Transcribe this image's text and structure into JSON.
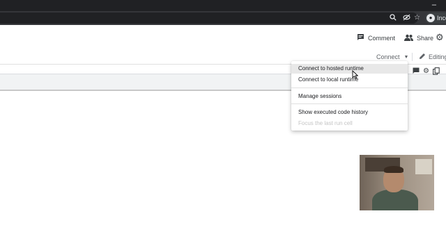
{
  "browser": {
    "incognito_label": "Inco",
    "icons": [
      "zoom-icon",
      "eye-off-icon",
      "star-icon",
      "incognito-icon"
    ],
    "minimize_glyph": "–"
  },
  "header": {
    "comment_label": "Comment",
    "share_label": "Share",
    "icons": [
      "comment-icon",
      "share-people-icon",
      "settings-gear-icon"
    ]
  },
  "toolbar": {
    "connect_label": "Connect",
    "editing_label": "Editing"
  },
  "cell_toolbar": {
    "icons": [
      "comment-icon",
      "gear-icon",
      "copy-icon"
    ]
  },
  "runtime_menu": {
    "items": [
      {
        "label": "Connect to hosted runtime",
        "enabled": true,
        "highlighted": true
      },
      {
        "label": "Connect to local runtime",
        "enabled": true
      },
      {
        "label": "Manage sessions",
        "enabled": true
      },
      {
        "label": "Show executed code history",
        "enabled": true
      },
      {
        "label": "Focus the last run cell",
        "enabled": false
      }
    ]
  },
  "colors": {
    "chrome_dark": "#202124",
    "menu_highlight": "#e8e8e8",
    "disabled_text": "#c4c4c4",
    "cell_strip": "#f1f3f4"
  }
}
